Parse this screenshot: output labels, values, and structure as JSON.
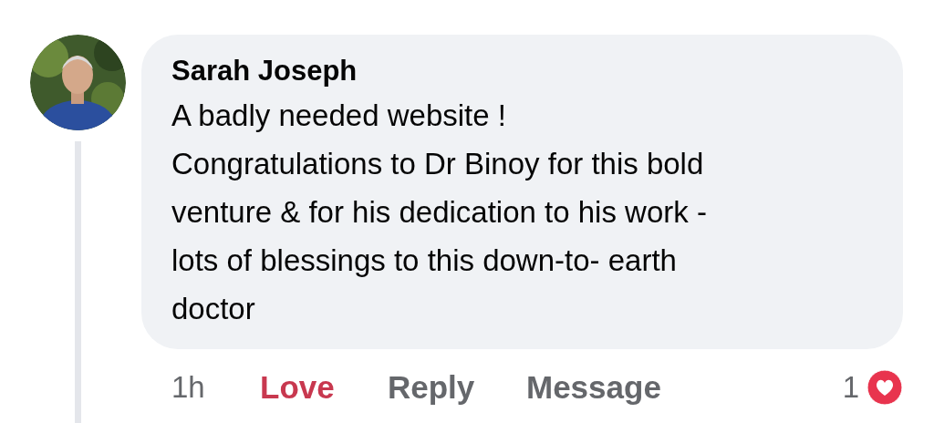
{
  "comment": {
    "author": "Sarah Joseph",
    "lines": [
      "A badly needed website !",
      "Congratulations to Dr Binoy for this bold",
      "venture & for his dedication to his work -",
      "lots of blessings to this down-to- earth",
      "doctor"
    ],
    "time": "1h",
    "actions": [
      {
        "label": "Love",
        "selected": true
      },
      {
        "label": "Reply",
        "selected": false
      },
      {
        "label": "Message",
        "selected": false
      }
    ],
    "reaction_count": "1"
  }
}
